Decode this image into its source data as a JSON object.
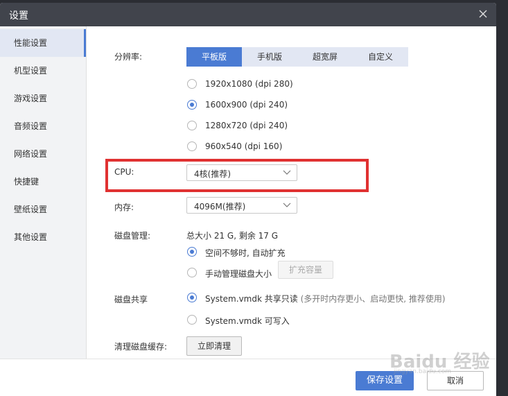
{
  "window": {
    "title": "设置"
  },
  "sidebar": {
    "items": [
      {
        "label": "性能设置",
        "active": true
      },
      {
        "label": "机型设置",
        "active": false
      },
      {
        "label": "游戏设置",
        "active": false
      },
      {
        "label": "音频设置",
        "active": false
      },
      {
        "label": "网络设置",
        "active": false
      },
      {
        "label": "快捷键",
        "active": false
      },
      {
        "label": "壁纸设置",
        "active": false
      },
      {
        "label": "其他设置",
        "active": false
      }
    ]
  },
  "resolution": {
    "label": "分辨率:",
    "tabs": [
      {
        "label": "平板版",
        "active": true
      },
      {
        "label": "手机版",
        "active": false
      },
      {
        "label": "超宽屏",
        "active": false
      },
      {
        "label": "自定义",
        "active": false
      }
    ],
    "options": [
      {
        "label": "1920x1080 (dpi 280)",
        "checked": false
      },
      {
        "label": "1600x900 (dpi 240)",
        "checked": true
      },
      {
        "label": "1280x720 (dpi 240)",
        "checked": false
      },
      {
        "label": "960x540 (dpi 160)",
        "checked": false
      }
    ]
  },
  "cpu": {
    "label": "CPU:",
    "value": "4核(推荐)"
  },
  "memory": {
    "label": "内存:",
    "value": "4096M(推荐)"
  },
  "disk": {
    "label": "磁盘管理:",
    "summary": "总大小 21 G, 剩余 17 G",
    "options": [
      {
        "label": "空间不够时, 自动扩充",
        "checked": true
      },
      {
        "label": "手动管理磁盘大小",
        "checked": false
      }
    ],
    "expand_button": "扩充容量"
  },
  "share": {
    "label": "磁盘共享",
    "options": [
      {
        "label": "System.vmdk 共享只读",
        "hint": "(多开时内存更小、启动更快, 推荐使用)",
        "checked": true
      },
      {
        "label": "System.vmdk 可写入",
        "hint": "",
        "checked": false
      }
    ]
  },
  "cache": {
    "label": "清理磁盘缓存:",
    "button": "立即清理"
  },
  "footer": {
    "save": "保存设置",
    "cancel": "取消"
  },
  "watermark": {
    "text": "Baidu 经验",
    "sub": "jingyan.baidu.com"
  },
  "colors": {
    "accent": "#4a7bd3",
    "titlebar": "#41444c",
    "highlight": "#e03131"
  }
}
